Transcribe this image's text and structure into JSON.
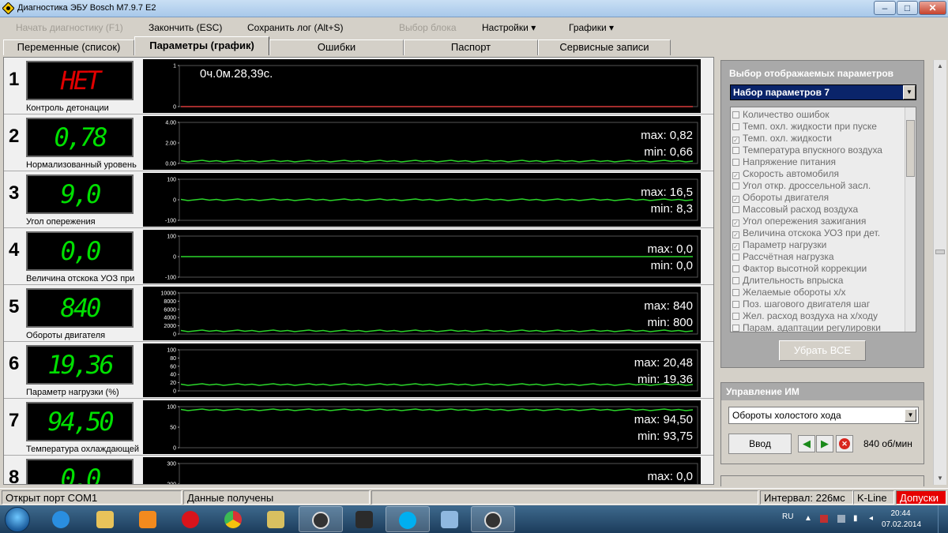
{
  "window": {
    "title": "Диагностика ЭБУ Bosch M7.9.7 E2"
  },
  "menu": {
    "start_diag": "Начать диагностику (F1)",
    "finish": "Закончить (ESC)",
    "save_log": "Сохранить лог (Alt+S)",
    "select_block": "Выбор блока",
    "settings": "Настройки",
    "graphs": "Графики",
    "dropdown_glyph": "▾"
  },
  "tabs": [
    "Переменные (список)",
    "Параметры (график)",
    "Ошибки",
    "Паспорт",
    "Сервисные записи"
  ],
  "timer": "0ч.0м.28,39с.",
  "rows": [
    {
      "num": "1",
      "value": "НЕТ",
      "label": "Контроль детонации",
      "ticks": [
        "1",
        "0"
      ],
      "max": "",
      "min": "",
      "led_color": "red"
    },
    {
      "num": "2",
      "value": "0,78",
      "label": "Нормализованный уровень",
      "ticks": [
        "4.00",
        "2.00",
        "0.00"
      ],
      "max": "max: 0,82",
      "min": "min: 0,66"
    },
    {
      "num": "3",
      "value": "9,0",
      "label": "Угол опережения",
      "ticks": [
        "100",
        "0",
        "-100"
      ],
      "max": "max: 16,5",
      "min": "min: 8,3"
    },
    {
      "num": "4",
      "value": "0,0",
      "label": "Величина отскока УОЗ при",
      "ticks": [
        "100",
        "0",
        "-100"
      ],
      "max": "max: 0,0",
      "min": "min: 0,0"
    },
    {
      "num": "5",
      "value": "840",
      "label": "Обороты двигателя",
      "ticks": [
        "10000",
        "8000",
        "6000",
        "4000",
        "2000",
        "0"
      ],
      "max": "max: 840",
      "min": "min: 800"
    },
    {
      "num": "6",
      "value": "19,36",
      "label": "Параметр нагрузки (%)",
      "ticks": [
        "100",
        "80",
        "60",
        "40",
        "20",
        "0"
      ],
      "max": "max: 20,48",
      "min": "min: 19,36"
    },
    {
      "num": "7",
      "value": "94,50",
      "label": "Температура охлаждающей",
      "ticks": [
        "100",
        "50",
        "0"
      ],
      "max": "max: 94,50",
      "min": "min: 93,75"
    },
    {
      "num": "8",
      "value": "0,0",
      "label": "",
      "ticks": [
        "300",
        "200",
        "100"
      ],
      "max": "max: 0,0",
      "min": ""
    }
  ],
  "params_panel": {
    "title": "Выбор отображаемых параметров",
    "set": "Набор параметров 7",
    "items": [
      {
        "label": "Количество ошибок",
        "checked": false
      },
      {
        "label": "Темп. охл. жидкости при пуске",
        "checked": false
      },
      {
        "label": "Темп. охл. жидкости",
        "checked": true
      },
      {
        "label": "Температура впускного воздуха",
        "checked": false
      },
      {
        "label": "Напряжение питания",
        "checked": false
      },
      {
        "label": "Скорость автомобиля",
        "checked": true
      },
      {
        "label": "Угол откр. дроссельной засл.",
        "checked": false
      },
      {
        "label": "Обороты двигателя",
        "checked": true
      },
      {
        "label": "Массовый расход воздуха",
        "checked": false
      },
      {
        "label": "Угол опережения зажигания",
        "checked": true
      },
      {
        "label": "Величина отскока УОЗ при дет.",
        "checked": true
      },
      {
        "label": "Параметр нагрузки",
        "checked": true
      },
      {
        "label": "Рассчётная нагрузка",
        "checked": false
      },
      {
        "label": "Фактор высотной коррекции",
        "checked": false
      },
      {
        "label": "Длительность впрыска",
        "checked": false
      },
      {
        "label": "Желаемые обороты х/х",
        "checked": false
      },
      {
        "label": "Поз. шагового двигателя шаг",
        "checked": false
      },
      {
        "label": "Жел. расход воздуха на х/ходу",
        "checked": false
      },
      {
        "label": "Парам. адаптации регулировки",
        "checked": false
      }
    ],
    "remove_all": "Убрать ВСЕ"
  },
  "im_panel": {
    "title": "Управление ИМ",
    "selected": "Обороты холостого хода",
    "enter": "Ввод",
    "value": "840 об/мин"
  },
  "status": {
    "port": "Открыт порт COM1",
    "data": "Данные получены",
    "interval": "Интервал: 226мс",
    "line": "K-Line",
    "downloads": "Допуски"
  },
  "taskbar": {
    "lang": "RU",
    "time": "20:44",
    "date": "07.02.2014"
  },
  "colors": {
    "led_green": "#00e000",
    "led_red": "#e00000",
    "graph_line": "#2bd62b",
    "accent_blue": "#0a246a",
    "status_red": "#e60000"
  }
}
